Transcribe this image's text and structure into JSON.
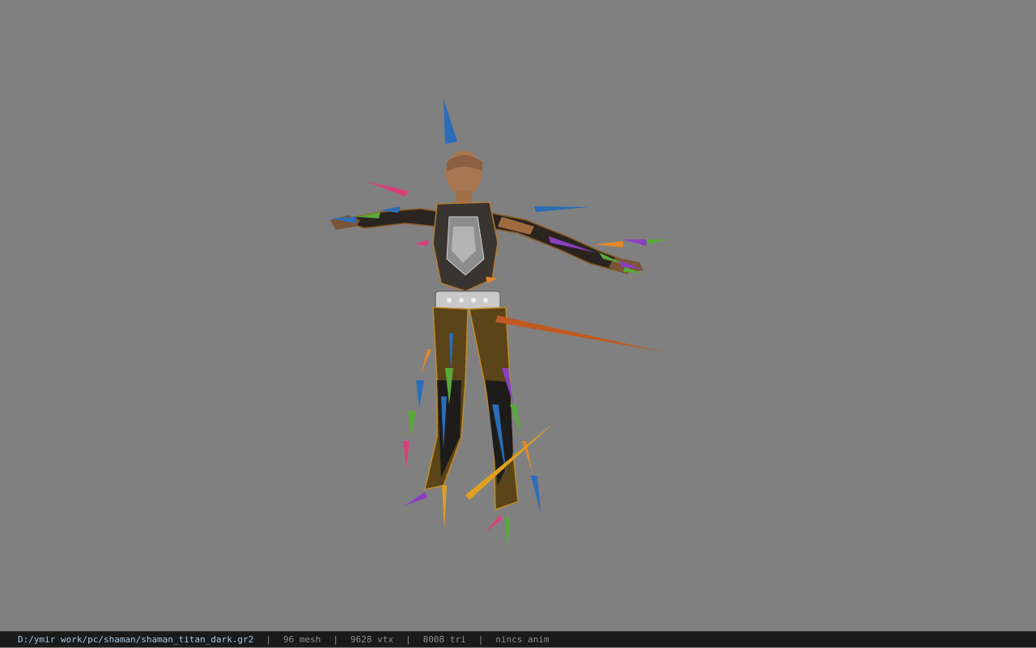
{
  "viewport": {
    "background_color": "#808080",
    "model_name": "shaman_titan_dark",
    "bone_colors": [
      "#2a6db8",
      "#d6427a",
      "#e0892a",
      "#8a3fc0",
      "#5aa83a",
      "#e0a020",
      "#c05a20"
    ]
  },
  "status_bar": {
    "file_path": "D:/ymir work/pc/shaman/shaman_titan_dark.gr2",
    "separator": "|",
    "mesh_count": "96 mesh",
    "vertex_count": "9628 vtx",
    "triangle_count": "8008 tri",
    "anim_status": "nincs anim"
  }
}
